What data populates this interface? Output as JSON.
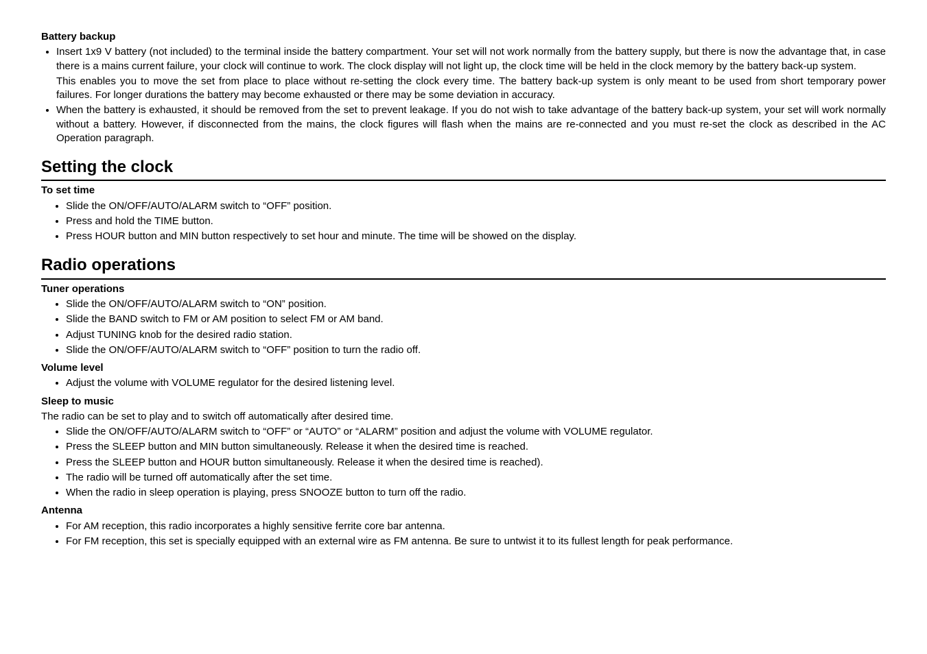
{
  "sections": {
    "batteryBackup": {
      "heading": "Battery backup",
      "items": [
        "Insert 1x9 V battery (not included) to the terminal inside the battery compartment. Your set will not work normally from the battery supply, but there is now the advantage that, in case there is a mains current failure, your clock will continue to work. The clock display will not light up, the clock time will be held in the clock memory by the battery back-up system.",
        "This enables you to move the set from place to place without re-setting the clock every time. The battery back-up system is only meant to be used from short temporary power failures. For longer durations the battery may become exhausted or there may be some deviation in accuracy.",
        "When the battery is exhausted, it should be removed from the set to prevent leakage. If you do not wish to take advantage of the battery back-up system, your set will work normally without a battery. However, if disconnected from the mains, the clock figures will flash when the mains are re-connected and you must re-set the clock as described in the AC Operation paragraph."
      ]
    },
    "settingClock": {
      "title": "Setting the clock",
      "toSetTime": {
        "heading": "To set time",
        "items": [
          "Slide the ON/OFF/AUTO/ALARM switch to “OFF” position.",
          "Press and hold the TIME button.",
          "Press HOUR button and MIN button respectively to set hour and minute. The time will be showed on the display."
        ]
      }
    },
    "radioOperations": {
      "title": "Radio operations",
      "tunerOperations": {
        "heading": "Tuner operations",
        "items": [
          "Slide the ON/OFF/AUTO/ALARM switch to “ON” position.",
          "Slide the BAND switch to FM or AM position to select FM or AM band.",
          "Adjust TUNING knob for the desired radio station.",
          "Slide the ON/OFF/AUTO/ALARM switch to “OFF” position to turn the radio off."
        ]
      },
      "volumeLevel": {
        "heading": "Volume level",
        "items": [
          "Adjust the volume with VOLUME regulator for the desired listening level."
        ]
      },
      "sleepToMusic": {
        "heading": "Sleep to music",
        "intro": "The radio can be set to play and to switch off automatically after desired time.",
        "items": [
          "Slide the ON/OFF/AUTO/ALARM switch to “OFF” or “AUTO” or “ALARM” position and adjust the volume with VOLUME regulator.",
          "Press the SLEEP button and MIN button simultaneously. Release it when the desired time is reached.",
          "Press the SLEEP button and HOUR button simultaneously. Release it when the desired time is reached).",
          "The radio will be turned off automatically after the set time.",
          "When the radio in sleep operation is playing, press SNOOZE button to turn off the radio."
        ]
      },
      "antenna": {
        "heading": "Antenna",
        "items": [
          "For AM reception, this radio incorporates a highly sensitive ferrite core bar antenna.",
          "For FM reception, this set is specially equipped with an external wire as FM antenna. Be sure to untwist it to its fullest length for peak performance."
        ]
      }
    }
  }
}
